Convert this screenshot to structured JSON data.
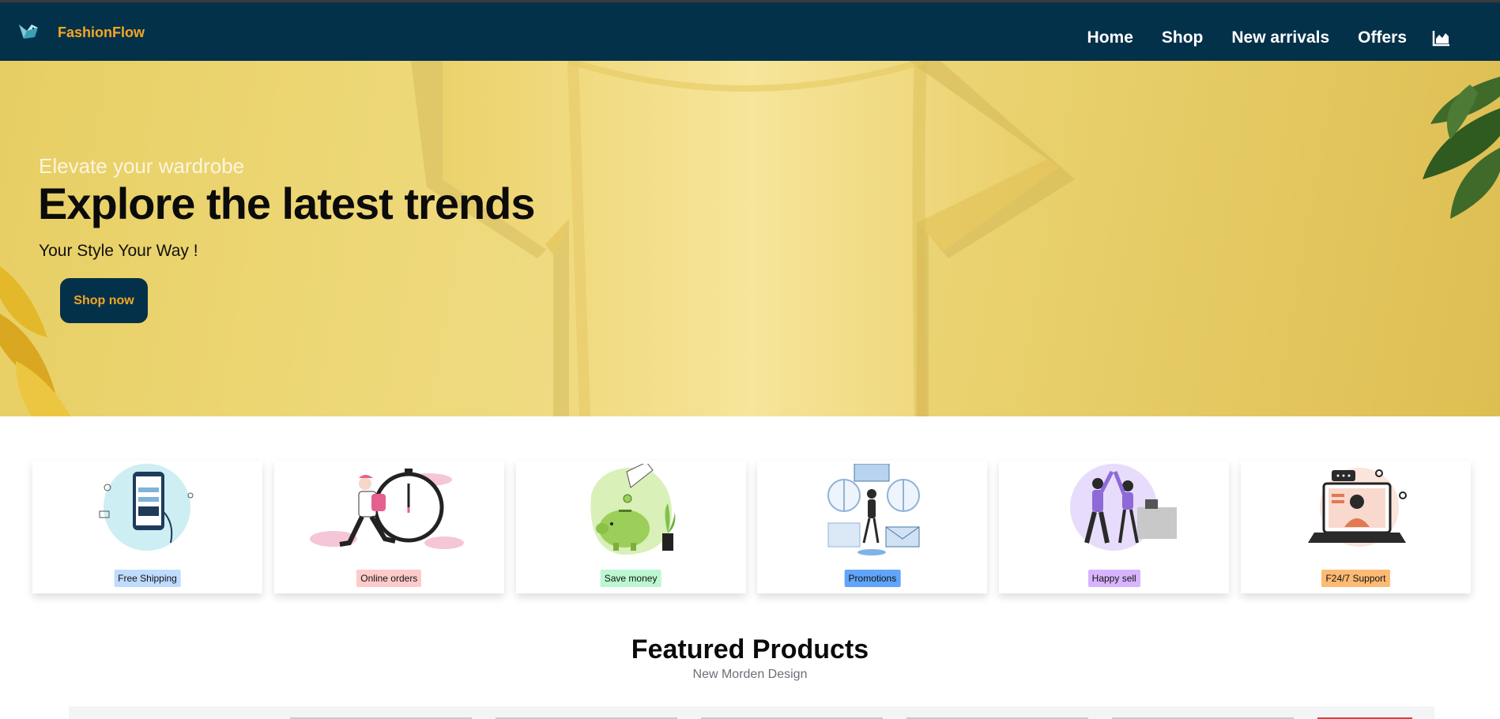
{
  "brand": {
    "name": "FashionFlow",
    "accent": "#f5a623",
    "header_bg": "#04314a",
    "logo_icon": "bird-logo-icon"
  },
  "nav": {
    "items": [
      "Home",
      "Shop",
      "New arrivals",
      "Offers"
    ],
    "chart_icon": "area-chart-icon"
  },
  "hero": {
    "kicker": "Elevate your wardrobe",
    "title": "Explore the latest trends",
    "tagline": "Your Style Your Way !",
    "cta": "Shop now"
  },
  "features": [
    {
      "label": "Free Shipping",
      "color": "#bfdbfe",
      "icon": "mobile-payment-illustration"
    },
    {
      "label": "Online orders",
      "color": "#fecaca",
      "icon": "delivery-clock-illustration"
    },
    {
      "label": "Save money",
      "color": "#bbf7d0",
      "icon": "piggy-bank-illustration"
    },
    {
      "label": "Promotions",
      "color": "#60a5fa",
      "icon": "promotion-window-illustration"
    },
    {
      "label": "Happy sell",
      "color": "#d8b4fe",
      "icon": "high-five-illustration"
    },
    {
      "label": "F24/7 Support",
      "color": "#fdba74",
      "icon": "support-laptop-illustration"
    }
  ],
  "featured": {
    "title": "Featured Products",
    "subtitle": "New Morden Design"
  }
}
